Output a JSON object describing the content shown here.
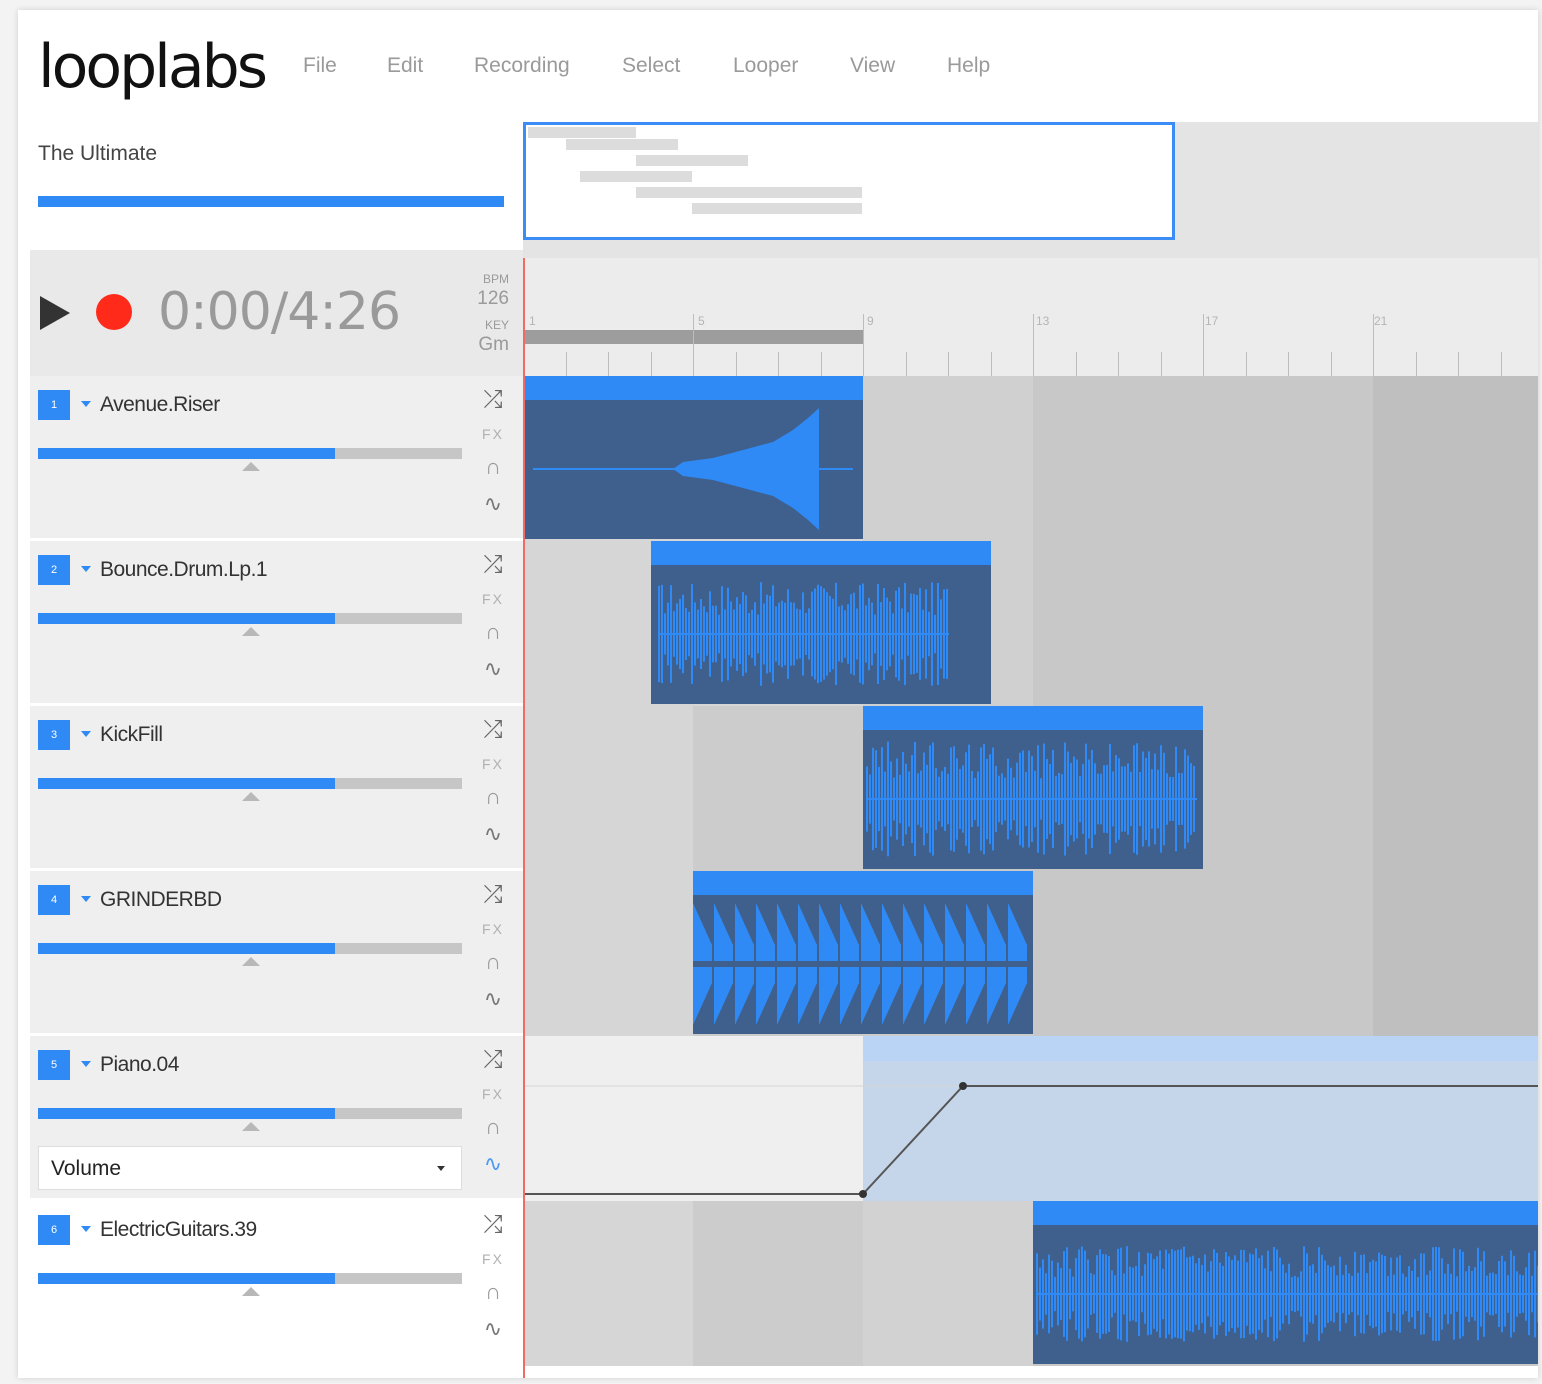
{
  "app": {
    "logo": "looplabs"
  },
  "menu": [
    "File",
    "Edit",
    "Recording",
    "Select",
    "Looper",
    "View",
    "Help"
  ],
  "project": {
    "title": "The Ultimate"
  },
  "transport": {
    "time": "0:00/4:26",
    "bpm_label": "BPM",
    "bpm": "126",
    "key_label": "KEY",
    "key": "Gm"
  },
  "ruler": {
    "bar_numbers": [
      "1",
      "5",
      "9",
      "13",
      "17",
      "21"
    ]
  },
  "tracks": [
    {
      "number": "1",
      "name": "Avenue.Riser",
      "volume": 0.7
    },
    {
      "number": "2",
      "name": "Bounce.Drum.Lp.1",
      "volume": 0.7
    },
    {
      "number": "3",
      "name": "KickFill",
      "volume": 0.7
    },
    {
      "number": "4",
      "name": "GRINDERBD",
      "volume": 0.7
    },
    {
      "number": "5",
      "name": "Piano.04",
      "volume": 0.7,
      "automation": "Volume"
    },
    {
      "number": "6",
      "name": "ElectricGuitars.39",
      "volume": 0.7
    }
  ],
  "track_icons": {
    "shuffle": "⤮",
    "fx": "FX",
    "headphones": "∩",
    "automation": "∿"
  },
  "colors": {
    "accent": "#2f8af5",
    "clip": "#3f5f8c",
    "record": "#ff2a1a",
    "playhead": "#f26a63"
  }
}
